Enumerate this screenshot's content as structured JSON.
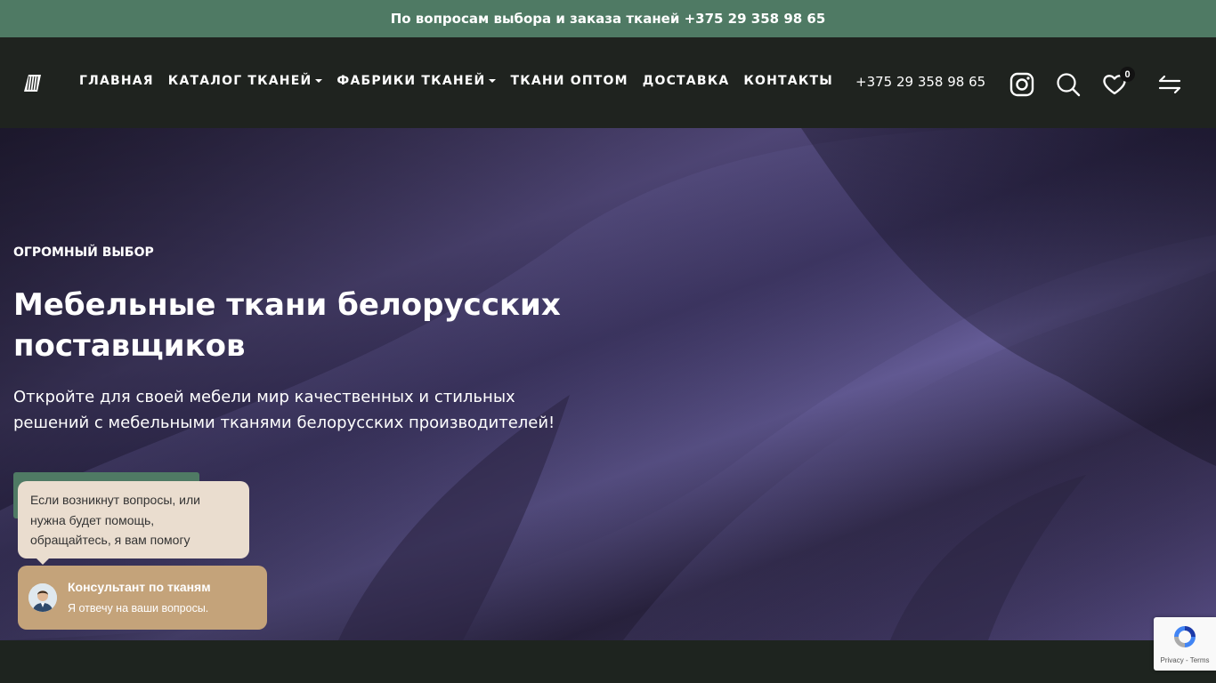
{
  "topbar": {
    "text": "По вопросам выбора и заказа тканей +375 29 358 98 65"
  },
  "header": {
    "nav": [
      {
        "label": "ГЛАВНАЯ",
        "dropdown": false
      },
      {
        "label": "КАТАЛОГ ТКАНЕЙ",
        "dropdown": true
      },
      {
        "label": "ФАБРИКИ ТКАНЕЙ",
        "dropdown": true
      },
      {
        "label": "ТКАНИ ОПТОМ",
        "dropdown": false
      },
      {
        "label": "ДОСТАВКА",
        "dropdown": false
      },
      {
        "label": "КОНТАКТЫ",
        "dropdown": false
      }
    ],
    "phone": "+375 29 358 98 65",
    "favorites_count": "0",
    "icons": [
      "logo-icon",
      "instagram-icon",
      "search-icon",
      "heart-icon",
      "compare-icon"
    ]
  },
  "hero": {
    "eyebrow": "ОГРОМНЫЙ ВЫБОР",
    "title": "Мебельные ткани белорусских поставщиков",
    "text": "Откройте для своей мебели мир качественных и стильных решений с мебельными тканями белорусских производителей!"
  },
  "chat": {
    "bubble": "Если возникнут вопросы, или нужна будет помощь, обращайтесь, я вам помогу",
    "title": "Консультант по тканям",
    "subtitle": "Я отвечу на ваши вопросы."
  },
  "recaptcha": {
    "links": "Privacy - Terms"
  },
  "colors": {
    "topbar": "#4f7a64",
    "header": "#1f231f",
    "fabric": "#5a5085",
    "chat_bubble": "#eaddcf",
    "chat_card": "#c4a37a"
  }
}
